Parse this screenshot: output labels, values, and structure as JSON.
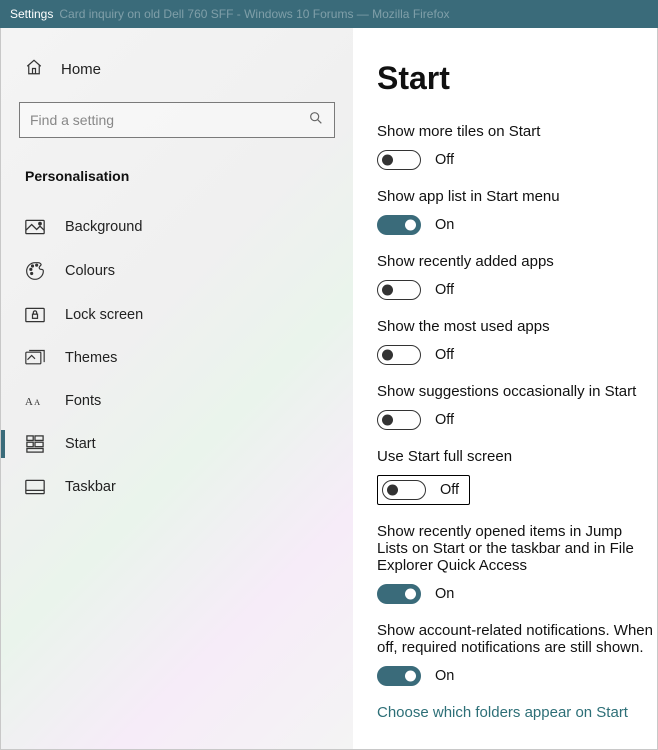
{
  "titlebar": {
    "app": "Settings",
    "background_hint": "Card inquiry on old Dell 760 SFF - Windows 10 Forums — Mozilla Firefox"
  },
  "sidebar": {
    "home": "Home",
    "search_placeholder": "Find a setting",
    "category": "Personalisation",
    "items": [
      {
        "icon": "background",
        "label": "Background"
      },
      {
        "icon": "colours",
        "label": "Colours"
      },
      {
        "icon": "lockscreen",
        "label": "Lock screen"
      },
      {
        "icon": "themes",
        "label": "Themes"
      },
      {
        "icon": "fonts",
        "label": "Fonts"
      },
      {
        "icon": "start",
        "label": "Start",
        "selected": true
      },
      {
        "icon": "taskbar",
        "label": "Taskbar"
      }
    ]
  },
  "main": {
    "heading": "Start",
    "toggle_states": {
      "on": "On",
      "off": "Off"
    },
    "settings": [
      {
        "label": "Show more tiles on Start",
        "on": false
      },
      {
        "label": "Show app list in Start menu",
        "on": true
      },
      {
        "label": "Show recently added apps",
        "on": false
      },
      {
        "label": "Show the most used apps",
        "on": false
      },
      {
        "label": "Show suggestions occasionally in Start",
        "on": false
      },
      {
        "label": "Use Start full screen",
        "on": false,
        "highlight": true
      },
      {
        "label": "Show recently opened items in Jump Lists on Start or the taskbar and in File Explorer Quick Access",
        "on": true
      },
      {
        "label": "Show account-related notifications. When off, required notifications are still shown.",
        "on": true
      }
    ],
    "link": "Choose which folders appear on Start"
  }
}
